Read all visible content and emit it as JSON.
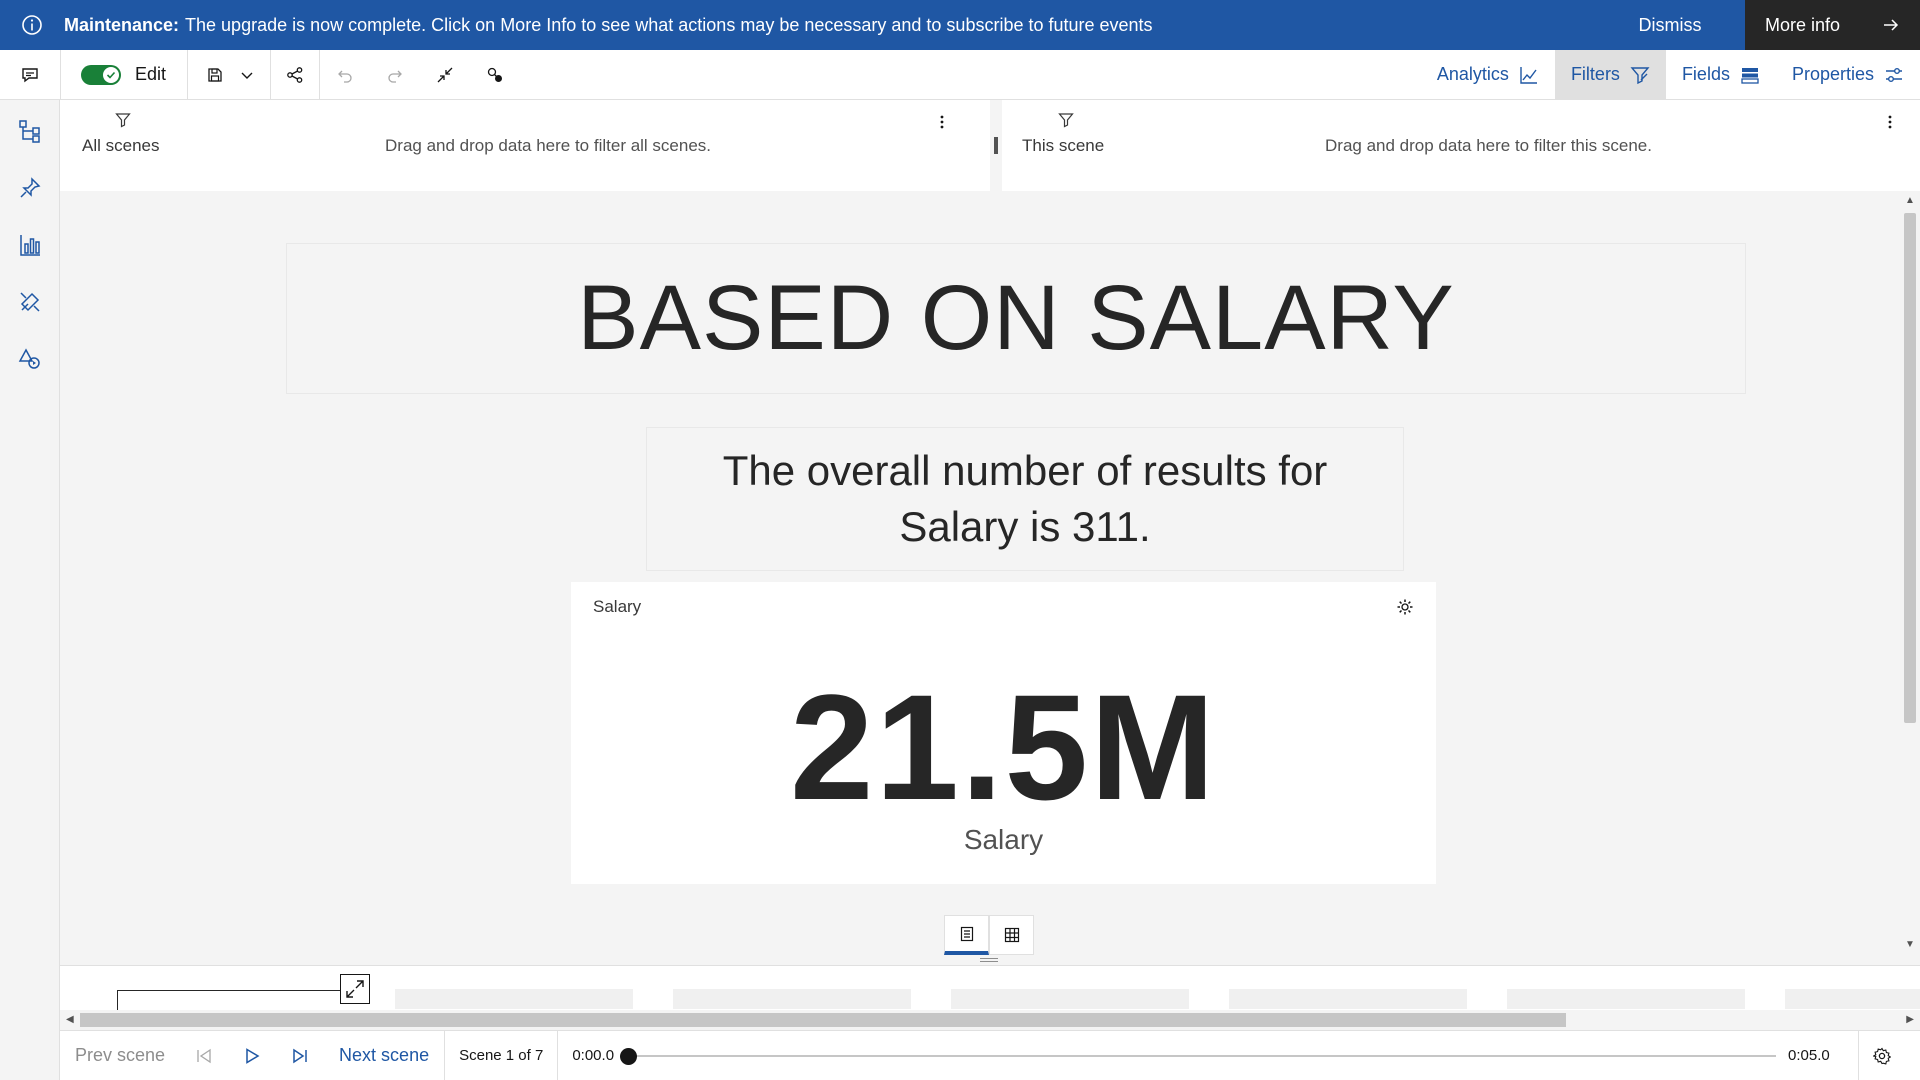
{
  "banner": {
    "prefix": "Maintenance:",
    "message": "The upgrade is now complete. Click on More Info to see what actions may be necessary and to subscribe to future events",
    "dismiss_label": "Dismiss",
    "more_label": "More info",
    "color": "#1f57a4"
  },
  "toolbar": {
    "edit_label": "Edit",
    "edit_on": true,
    "tabs": [
      {
        "label": "Analytics",
        "icon": "line-chart-icon",
        "active": false
      },
      {
        "label": "Filters",
        "icon": "filter-icon",
        "active": true
      },
      {
        "label": "Fields",
        "icon": "fields-icon",
        "active": false
      },
      {
        "label": "Properties",
        "icon": "sliders-icon",
        "active": false
      }
    ]
  },
  "leftnav": {
    "icons": [
      "comment-icon",
      "hierarchy-icon",
      "pin-icon",
      "bar-chart-icon",
      "widgets-icon",
      "shapes-icon"
    ]
  },
  "filters": {
    "all": {
      "label": "All scenes",
      "hint": "Drag and drop data here to filter all scenes."
    },
    "scene": {
      "label": "This scene",
      "hint": "Drag and drop data here to filter this scene."
    }
  },
  "canvas": {
    "title": "BASED ON SALARY",
    "description": "The overall number of results for Salary is 311.",
    "kpi": {
      "title": "Salary",
      "value": "21.5M",
      "label": "Salary"
    }
  },
  "playback": {
    "prev_label": "Prev scene",
    "next_label": "Next scene",
    "scene_indicator": "Scene 1 of 7",
    "time_start": "0:00.0",
    "time_end": "0:05.0",
    "progress": 0
  },
  "colors": {
    "accent": "#1f57a4",
    "toggle_on": "#198038"
  }
}
